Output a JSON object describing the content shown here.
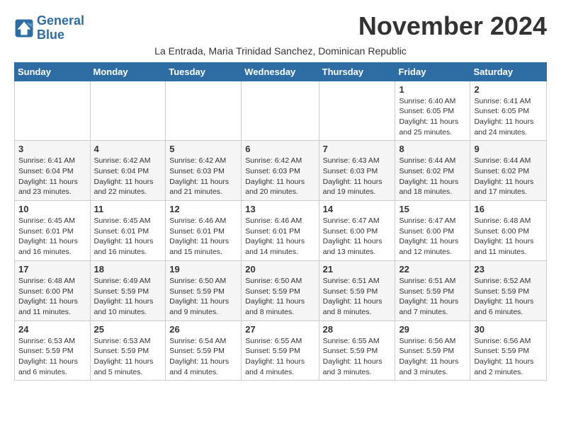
{
  "logo": {
    "line1": "General",
    "line2": "Blue"
  },
  "title": "November 2024",
  "subtitle": "La Entrada, Maria Trinidad Sanchez, Dominican Republic",
  "days_of_week": [
    "Sunday",
    "Monday",
    "Tuesday",
    "Wednesday",
    "Thursday",
    "Friday",
    "Saturday"
  ],
  "weeks": [
    [
      {
        "day": "",
        "info": ""
      },
      {
        "day": "",
        "info": ""
      },
      {
        "day": "",
        "info": ""
      },
      {
        "day": "",
        "info": ""
      },
      {
        "day": "",
        "info": ""
      },
      {
        "day": "1",
        "info": "Sunrise: 6:40 AM\nSunset: 6:05 PM\nDaylight: 11 hours\nand 25 minutes."
      },
      {
        "day": "2",
        "info": "Sunrise: 6:41 AM\nSunset: 6:05 PM\nDaylight: 11 hours\nand 24 minutes."
      }
    ],
    [
      {
        "day": "3",
        "info": "Sunrise: 6:41 AM\nSunset: 6:04 PM\nDaylight: 11 hours\nand 23 minutes."
      },
      {
        "day": "4",
        "info": "Sunrise: 6:42 AM\nSunset: 6:04 PM\nDaylight: 11 hours\nand 22 minutes."
      },
      {
        "day": "5",
        "info": "Sunrise: 6:42 AM\nSunset: 6:03 PM\nDaylight: 11 hours\nand 21 minutes."
      },
      {
        "day": "6",
        "info": "Sunrise: 6:42 AM\nSunset: 6:03 PM\nDaylight: 11 hours\nand 20 minutes."
      },
      {
        "day": "7",
        "info": "Sunrise: 6:43 AM\nSunset: 6:03 PM\nDaylight: 11 hours\nand 19 minutes."
      },
      {
        "day": "8",
        "info": "Sunrise: 6:44 AM\nSunset: 6:02 PM\nDaylight: 11 hours\nand 18 minutes."
      },
      {
        "day": "9",
        "info": "Sunrise: 6:44 AM\nSunset: 6:02 PM\nDaylight: 11 hours\nand 17 minutes."
      }
    ],
    [
      {
        "day": "10",
        "info": "Sunrise: 6:45 AM\nSunset: 6:01 PM\nDaylight: 11 hours\nand 16 minutes."
      },
      {
        "day": "11",
        "info": "Sunrise: 6:45 AM\nSunset: 6:01 PM\nDaylight: 11 hours\nand 16 minutes."
      },
      {
        "day": "12",
        "info": "Sunrise: 6:46 AM\nSunset: 6:01 PM\nDaylight: 11 hours\nand 15 minutes."
      },
      {
        "day": "13",
        "info": "Sunrise: 6:46 AM\nSunset: 6:01 PM\nDaylight: 11 hours\nand 14 minutes."
      },
      {
        "day": "14",
        "info": "Sunrise: 6:47 AM\nSunset: 6:00 PM\nDaylight: 11 hours\nand 13 minutes."
      },
      {
        "day": "15",
        "info": "Sunrise: 6:47 AM\nSunset: 6:00 PM\nDaylight: 11 hours\nand 12 minutes."
      },
      {
        "day": "16",
        "info": "Sunrise: 6:48 AM\nSunset: 6:00 PM\nDaylight: 11 hours\nand 11 minutes."
      }
    ],
    [
      {
        "day": "17",
        "info": "Sunrise: 6:48 AM\nSunset: 6:00 PM\nDaylight: 11 hours\nand 11 minutes."
      },
      {
        "day": "18",
        "info": "Sunrise: 6:49 AM\nSunset: 5:59 PM\nDaylight: 11 hours\nand 10 minutes."
      },
      {
        "day": "19",
        "info": "Sunrise: 6:50 AM\nSunset: 5:59 PM\nDaylight: 11 hours\nand 9 minutes."
      },
      {
        "day": "20",
        "info": "Sunrise: 6:50 AM\nSunset: 5:59 PM\nDaylight: 11 hours\nand 8 minutes."
      },
      {
        "day": "21",
        "info": "Sunrise: 6:51 AM\nSunset: 5:59 PM\nDaylight: 11 hours\nand 8 minutes."
      },
      {
        "day": "22",
        "info": "Sunrise: 6:51 AM\nSunset: 5:59 PM\nDaylight: 11 hours\nand 7 minutes."
      },
      {
        "day": "23",
        "info": "Sunrise: 6:52 AM\nSunset: 5:59 PM\nDaylight: 11 hours\nand 6 minutes."
      }
    ],
    [
      {
        "day": "24",
        "info": "Sunrise: 6:53 AM\nSunset: 5:59 PM\nDaylight: 11 hours\nand 6 minutes."
      },
      {
        "day": "25",
        "info": "Sunrise: 6:53 AM\nSunset: 5:59 PM\nDaylight: 11 hours\nand 5 minutes."
      },
      {
        "day": "26",
        "info": "Sunrise: 6:54 AM\nSunset: 5:59 PM\nDaylight: 11 hours\nand 4 minutes."
      },
      {
        "day": "27",
        "info": "Sunrise: 6:55 AM\nSunset: 5:59 PM\nDaylight: 11 hours\nand 4 minutes."
      },
      {
        "day": "28",
        "info": "Sunrise: 6:55 AM\nSunset: 5:59 PM\nDaylight: 11 hours\nand 3 minutes."
      },
      {
        "day": "29",
        "info": "Sunrise: 6:56 AM\nSunset: 5:59 PM\nDaylight: 11 hours\nand 3 minutes."
      },
      {
        "day": "30",
        "info": "Sunrise: 6:56 AM\nSunset: 5:59 PM\nDaylight: 11 hours\nand 2 minutes."
      }
    ]
  ]
}
